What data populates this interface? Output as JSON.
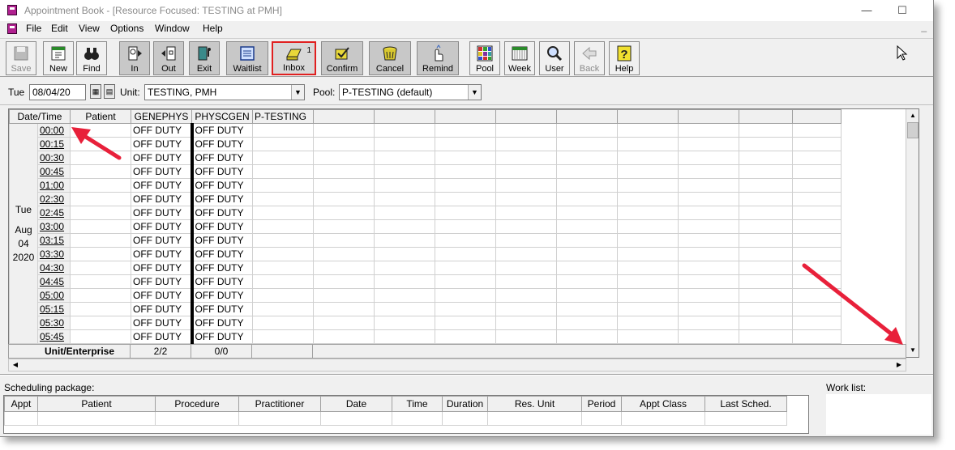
{
  "window": {
    "title": "Appointment Book - [Resource Focused:  TESTING at PMH]",
    "minimize": "—",
    "maximize": "☐",
    "restore_child": "_"
  },
  "menu": [
    "File",
    "Edit",
    "View",
    "Options",
    "Window",
    "Help"
  ],
  "toolbar": {
    "save": "Save",
    "new": "New",
    "find": "Find",
    "in": "In",
    "out": "Out",
    "exit": "Exit",
    "waitlist": "Waitlist",
    "inbox": "Inbox",
    "inbox_count": "1",
    "confirm": "Confirm",
    "cancel": "Cancel",
    "remind": "Remind",
    "pool": "Pool",
    "week": "Week",
    "user": "User",
    "back": "Back",
    "help": "Help"
  },
  "filter": {
    "day": "Tue",
    "date": "08/04/20",
    "unit_label": "Unit:",
    "unit_value": "TESTING, PMH",
    "pool_label": "Pool:",
    "pool_value": "P-TESTING (default)"
  },
  "grid": {
    "headers": [
      "Date/Time",
      "Patient",
      "GENEPHYS",
      "PHYSCGEN",
      "P-TESTING"
    ],
    "date_day": "Tue",
    "date_month": "Aug",
    "date_dom": "04",
    "date_year": "2020",
    "times": [
      "00:00",
      "00:15",
      "00:30",
      "00:45",
      "01:00",
      "02:30",
      "02:45",
      "03:00",
      "03:15",
      "03:30",
      "04:30",
      "04:45",
      "05:00",
      "05:15",
      "05:30",
      "05:45"
    ],
    "off_duty": "OFF DUTY",
    "footer_label": "Unit/Enterprise",
    "footer_genephys": "2/2",
    "footer_physcgen": "0/0"
  },
  "scheduling": {
    "label": "Scheduling package:",
    "columns": [
      "Appt",
      "Patient",
      "Procedure",
      "Practitioner",
      "Date",
      "Time",
      "Duration",
      "Res. Unit",
      "Period",
      "Appt Class",
      "Last Sched."
    ]
  },
  "worklist": {
    "label": "Work list:"
  },
  "colors": {
    "annotation_arrow": "#e8203a",
    "inbox_border": "#e02020"
  }
}
